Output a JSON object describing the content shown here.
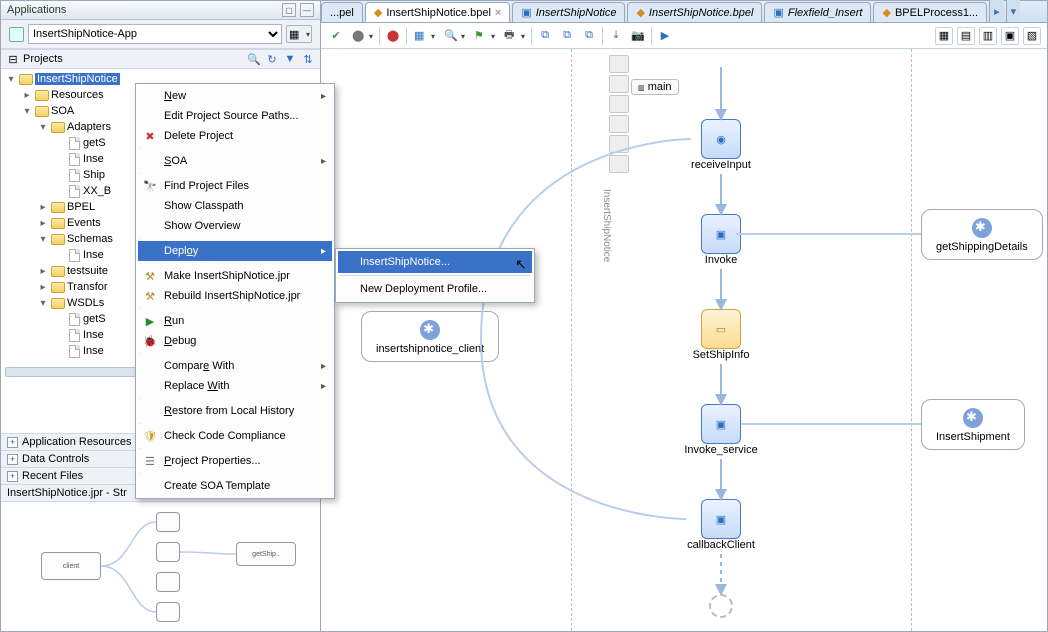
{
  "applications": {
    "panel_title": "Applications",
    "dropdown": "InsertShipNotice-App"
  },
  "projects": {
    "title": "Projects",
    "nodes": {
      "root": "InsertShipNotice",
      "resources": "Resources",
      "soa": "SOA",
      "adapters": "Adapters",
      "gets": "getS",
      "inse1": "Inse",
      "ship": "Ship",
      "xxb": "XX_B",
      "bpel": "BPEL",
      "events": "Events",
      "schemas": "Schemas",
      "inse2": "Inse",
      "testsuite": "testsuite",
      "transfor": "Transfor",
      "wsdls": "WSDLs",
      "gets2": "getS",
      "inse3": "Inse",
      "inse4": "Inse"
    }
  },
  "accordion": {
    "app_resources": "Application Resources",
    "data_controls": "Data Controls",
    "recent_files": "Recent Files"
  },
  "structure": {
    "title": "InsertShipNotice.jpr - Str"
  },
  "tabs": {
    "t0": "...pel",
    "t1": "InsertShipNotice.bpel",
    "t2": "InsertShipNotice",
    "t3": "InsertShipNotice.bpel",
    "t4": "Flexfield_Insert",
    "t5": "BPELProcess1..."
  },
  "context_menu": {
    "new": "New",
    "edit_paths": "Edit Project Source Paths...",
    "delete": "Delete Project",
    "soa": "SOA",
    "find": "Find Project Files",
    "classpath": "Show Classpath",
    "overview": "Show Overview",
    "deploy": "Deploy",
    "make": "Make InsertShipNotice.jpr",
    "rebuild": "Rebuild InsertShipNotice.jpr",
    "run": "Run",
    "debug": "Debug",
    "compare": "Compare With",
    "replace": "Replace With",
    "restore": "Restore from Local History",
    "checkcode": "Check Code Compliance",
    "props": "Project Properties...",
    "create_soa": "Create SOA Template"
  },
  "submenu": {
    "item1": "InsertShipNotice...",
    "item2": "New Deployment Profile..."
  },
  "diagram": {
    "swim_label": "InsertShipNotice",
    "main": "main",
    "client": "insertshipnotice_client",
    "receive": "receiveInput",
    "invoke": "Invoke",
    "setship": "SetShipInfo",
    "invoke_svc": "Invoke_service",
    "callback": "callbackClient",
    "getship": "getShippingDetails",
    "insertship": "InsertShipment"
  }
}
